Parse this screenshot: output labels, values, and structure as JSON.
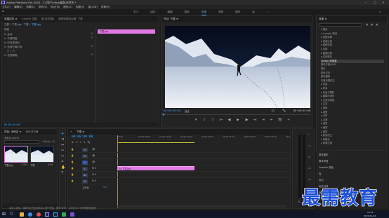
{
  "titlebar": {
    "title": "Adobe Premiere Pro 2020 - C:\\用户\\nfbq\\桌面\\未命名 *",
    "min": "–",
    "max": "□",
    "close": "✕"
  },
  "menubar": {
    "items": [
      "文件(F)",
      "编辑(E)",
      "剪辑(C)",
      "序列(S)",
      "标记(M)",
      "图形(G)",
      "视图(V)",
      "窗口(W)",
      "帮助(H)"
    ]
  },
  "workspaces": {
    "items": [
      "学习",
      "组件",
      "编辑",
      "颜色",
      "效果",
      "音频",
      "图形",
      "库"
    ],
    "active_index": 4,
    "more": "»"
  },
  "effect_controls": {
    "tabs": [
      "效果控件 ≡",
      "Lumetri 范围",
      "源:(无剪辑)",
      "音频剪辑混合器: 下雪"
    ],
    "source_label": "主要 * 下雪.jpg",
    "seq_label": "下雪 * 下雪.jpg",
    "clip_name": "下雪.jpg",
    "video_label": "视频",
    "rows": [
      "fx 运动",
      "fx 不透明度",
      "fx 时间重映射",
      "fx 色调分离时间",
      "□  ○  ✎",
      "fx 快速模糊"
    ],
    "timecode": "00:00:00:00"
  },
  "program_monitor": {
    "tab": "节目: 下雪 ≡",
    "timecode_left": "00:00:00:00",
    "fit": "适合",
    "scale": "1/2",
    "timecode_right": "00:00:05:00"
  },
  "transport": {
    "buttons": [
      "▾",
      "{",
      "}",
      "|←",
      "◀|",
      "▶",
      "|▶",
      "→|",
      "⇥",
      "⇤",
      "📷",
      "+"
    ]
  },
  "project_panel": {
    "tabs": [
      "项目: 未命名 ≡",
      "媒体浏览器"
    ],
    "file_name": "未命名.prproj",
    "item_count": "1 项中的 1 项",
    "items": [
      {
        "name": "下雪.jpg",
        "duration": "5:00"
      },
      {
        "name": "下雪",
        "duration": "5:00"
      }
    ]
  },
  "tools": {
    "items": [
      "selection-tool",
      "track-select-tool",
      "ripple-edit-tool",
      "razor-tool",
      "slip-tool",
      "pen-tool",
      "hand-tool",
      "type-tool"
    ]
  },
  "timeline": {
    "tab": "下雪 ≡",
    "timecode": "00:00:00:00",
    "ruler": [
      "00:00",
      "00:00:05:00",
      "00:00:10:00",
      "00:00:15:00",
      "00:00:20:00",
      "00:00:25:00",
      "00:00:30:00",
      "00:00:35:00",
      "00:00:40:00"
    ],
    "video_tracks": [
      "V3",
      "V2",
      "V1"
    ],
    "audio_tracks": [
      "A1",
      "A2",
      "A3"
    ],
    "master_label": "主声道",
    "master_value": "0.0",
    "clip_label": "fx 下雪.jpg",
    "colors": {
      "clip": "#e27ae4",
      "clip_header": "#d863db",
      "source_clip": "#e27ae4"
    }
  },
  "effects_panel": {
    "tab": "效果 ≡",
    "tree": [
      "▸ 预设",
      "▸ Lumetri 预设",
      "▸ 音频效果",
      "▸ 音频过渡",
      "▾ 视频效果",
      "  ▸ 变换",
      "  ▸ 图像控制",
      "  ▾ 实用程序",
      "      Cineon 转换器",
      "      颜色平衡(HLS)",
      "      黑白",
      "      颜色过滤",
      "      颜色替换",
      "      灰度系数校正",
      "  ▸ 扭曲",
      "  ▸ 时间",
      "  ▸ 杂色与颗粒",
      "  ▸ 模糊与锐化",
      "  ▸ 沉浸式视频",
      "  ▸ 生成",
      "  ▸ 视频",
      "  ▸ 调整",
      "  ▸ 过时",
      "  ▸ 过渡",
      "  ▸ 透视",
      "  ▸ 通道",
      "  ▸ 键控",
      "  ▸ 颜色校正",
      "  ▸ 风格化",
      "▸ 视频过渡"
    ],
    "selected_index": 8,
    "bottom_sections": [
      "基本图形",
      "基本声音",
      "Lumetri 颜色",
      "库",
      "标记",
      "历史记录",
      "信息"
    ]
  },
  "audio_meter": {
    "labels": [
      "0",
      "-12",
      "-24",
      "-36",
      "-48",
      "dB"
    ],
    "solo": "S",
    "solo2": "S"
  },
  "status_bar": {
    "text": "单击以选择，或单击空白处并拖动以进行框选。使用 Shift、Alt 和 Ctrl 可获得其他选项。"
  },
  "taskbar": {
    "time": "14:51",
    "date": "2021/11/12"
  },
  "watermark": {
    "text": "最需教育"
  }
}
